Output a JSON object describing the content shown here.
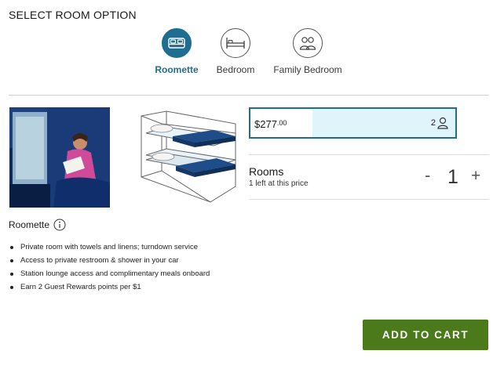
{
  "header": {
    "title": "SELECT ROOM OPTION"
  },
  "room_options": [
    {
      "label": "Roomette",
      "icon": "bed-icon",
      "selected": true
    },
    {
      "label": "Bedroom",
      "icon": "bed-room-icon",
      "selected": false
    },
    {
      "label": "Family Bedroom",
      "icon": "family-icon",
      "selected": false
    }
  ],
  "price": {
    "dollars": "$277",
    "cents": ".00",
    "guests": "2"
  },
  "rooms": {
    "label": "Rooms",
    "availability": "1 left at this price",
    "quantity": "1",
    "minus": "-",
    "plus": "+"
  },
  "room_detail": {
    "name": "Roomette",
    "features": [
      "Private room with towels and linens; turndown service",
      "Access to private restroom & shower in your car",
      "Station lounge access and complimentary meals onboard",
      "Earn 2 Guest Rewards points per $1"
    ]
  },
  "cart": {
    "button_label": "ADD TO CART"
  },
  "colors": {
    "accent": "#1f6d91",
    "price_bg": "#dff5fb",
    "button": "#4a7a1a"
  }
}
